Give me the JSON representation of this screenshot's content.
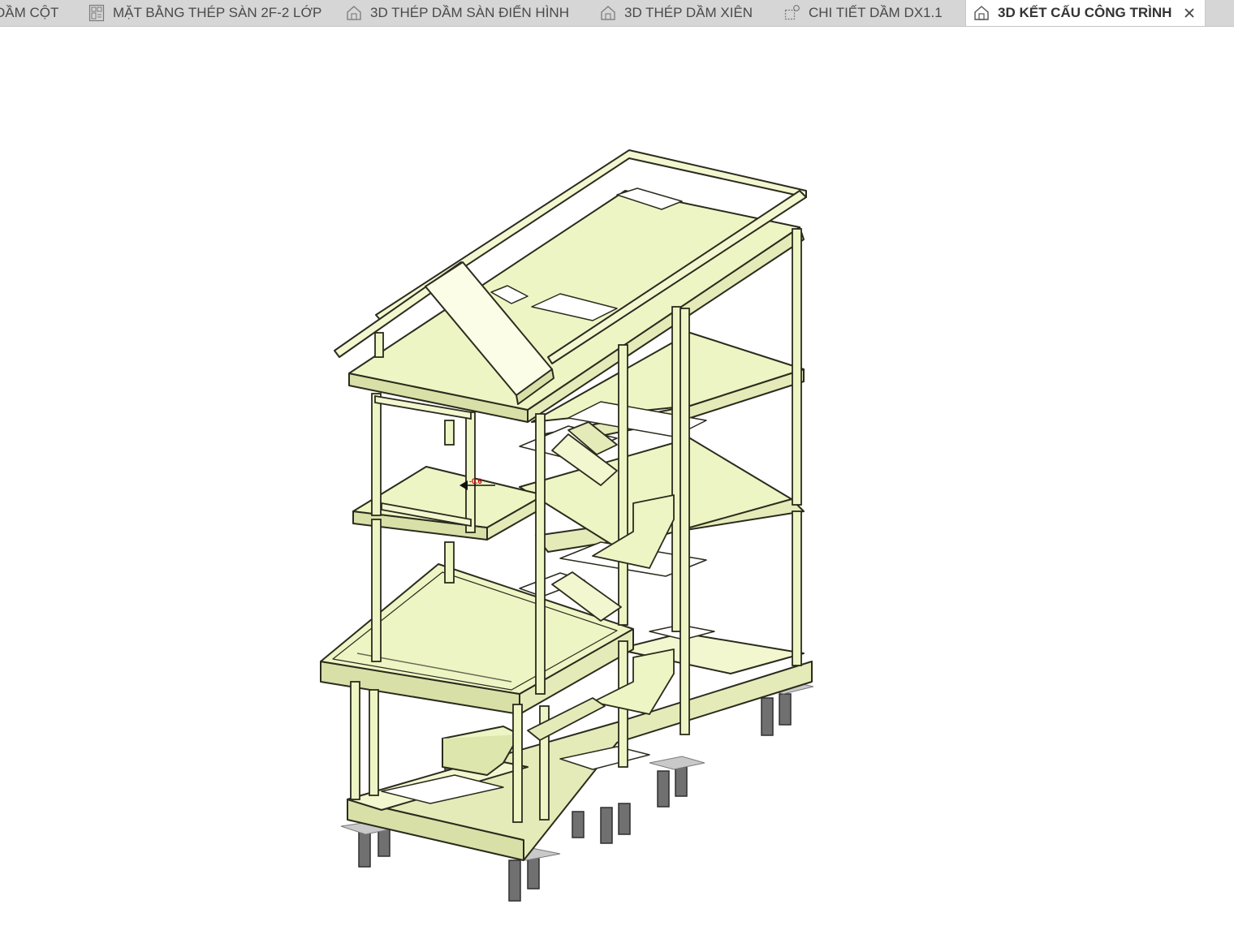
{
  "tabs": [
    {
      "label": "DẦM CỘT",
      "icon": "plan-view-icon",
      "active": false
    },
    {
      "label": "MẶT BẰNG THÉP SÀN 2F-2 LỚP",
      "icon": "floor-plan-icon",
      "active": false
    },
    {
      "label": "3D THÉP DẦM SÀN ĐIỂN HÌNH",
      "icon": "3d-view-icon",
      "active": false
    },
    {
      "label": "3D THÉP DẦM XIÊN",
      "icon": "3d-view-icon",
      "active": false
    },
    {
      "label": "CHI TIẾT DẦM DX1.1",
      "icon": "detail-view-icon",
      "active": false
    },
    {
      "label": "3D KẾT CẤU CÔNG TRÌNH",
      "icon": "3d-view-icon",
      "active": true
    }
  ],
  "colors": {
    "tabbar_bg": "#d6d6d6",
    "active_tab_bg": "#ffffff",
    "concrete_fill": "#eef5c4",
    "concrete_light": "#f7fbdf",
    "concrete_shadow": "#d3dc9f",
    "edge": "#2b2b1e",
    "pile": "#6a6a6a",
    "section_mark": "#cc0000"
  },
  "viewport": {
    "view_type": "3D structural model",
    "level_marker": "-0.6"
  }
}
